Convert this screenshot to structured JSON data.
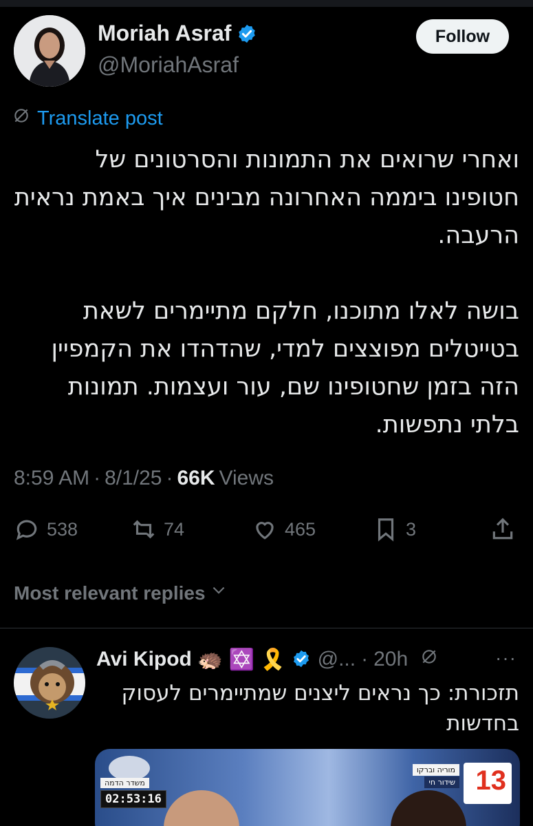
{
  "post": {
    "author_name": "Moriah Asraf",
    "author_handle": "@MoriahAsraf",
    "follow_label": "Follow",
    "translate_label": "Translate post",
    "text": "ואחרי שרואים את התמונות והסרטונים של חטופינו ביממה האחרונה מבינים איך באמת נראית הרעבה.\n\nבושה לאלו מתוכנו, חלקם מתיימרים לשאת בטייטלים מפוצצים למדי, שהדהדו את הקמפיין הזה בזמן שחטופינו שם, עור ועצמות. תמונות בלתי נתפשות.",
    "time": "8:59 AM",
    "date": "8/1/25",
    "views_count": "66K",
    "views_label": "Views",
    "stats": {
      "replies": "538",
      "reposts": "74",
      "likes": "465",
      "bookmarks": "3"
    }
  },
  "replies_filter_label": "Most relevant replies",
  "reply": {
    "author_name": "Avi Kipod",
    "emojis": "🦔 ✡️ 🎗️",
    "handle": "@...",
    "time": "20h",
    "more": "···",
    "text": "תזכורת: כך נראים ליצנים שמתיימרים לעסוק בחדשות",
    "media": {
      "timestamp": "02:53:16",
      "badge_top": "משדר הדמה",
      "ribbon": "מוריה וברקו",
      "ribbon2": "שידור חי",
      "channel": "13"
    }
  },
  "colors": {
    "accent": "#1d9bf0",
    "text": "#e7e9ea",
    "secondary": "#71767b",
    "background": "#000000"
  }
}
